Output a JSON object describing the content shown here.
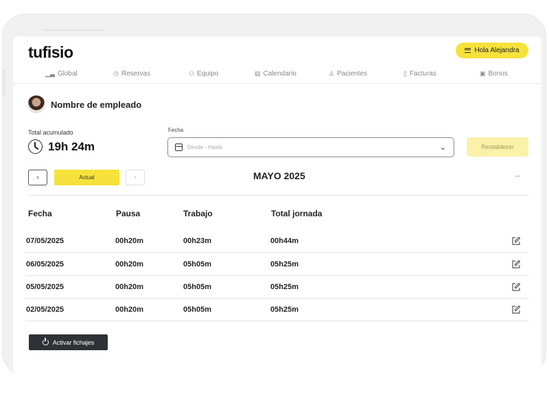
{
  "app": {
    "logo_main": "tufisio",
    "user_button": "Hola Alejandra"
  },
  "nav": {
    "items": [
      {
        "label": "Global",
        "icon": "bar-chart-icon"
      },
      {
        "label": "Reservas",
        "icon": "clock-icon"
      },
      {
        "label": "Equipo",
        "icon": "users-icon"
      },
      {
        "label": "Calendario",
        "icon": "calendar-icon"
      },
      {
        "label": "Pacientes",
        "icon": "user-add-icon"
      },
      {
        "label": "Facturas",
        "icon": "document-icon"
      },
      {
        "label": "Bonos",
        "icon": "ticket-icon"
      }
    ]
  },
  "employee": {
    "name": "Nombre de empleado"
  },
  "summary": {
    "total_label": "Total acumulado",
    "total_value": "19h 24m"
  },
  "filter": {
    "fecha_label": "Fecha",
    "date_placeholder": "Desde - Hasta",
    "reset_label": "Restablecer"
  },
  "period": {
    "prev": "‹",
    "current_label": "Actual",
    "next": "›",
    "month": "MAYO 2025",
    "more": "···"
  },
  "table": {
    "headers": [
      "Fecha",
      "Pausa",
      "Trabajo",
      "Total jornada"
    ],
    "rows": [
      {
        "fecha": "07/05/2025",
        "pausa": "00h20m",
        "trabajo": "00h23m",
        "total": "00h44m"
      },
      {
        "fecha": "06/05/2025",
        "pausa": "00h20m",
        "trabajo": "05h05m",
        "total": "05h25m"
      },
      {
        "fecha": "05/05/2025",
        "pausa": "00h20m",
        "trabajo": "05h05m",
        "total": "05h25m"
      },
      {
        "fecha": "02/05/2025",
        "pausa": "00h20m",
        "trabajo": "05h05m",
        "total": "05h25m"
      }
    ]
  },
  "actions": {
    "activar_label": "Activar fichajes"
  },
  "colors": {
    "accent_yellow": "#f7e23c",
    "accent_yellow_light": "#fbf1a8",
    "dark_button": "#2e3236",
    "logo_dot": "#1bb8a4"
  }
}
